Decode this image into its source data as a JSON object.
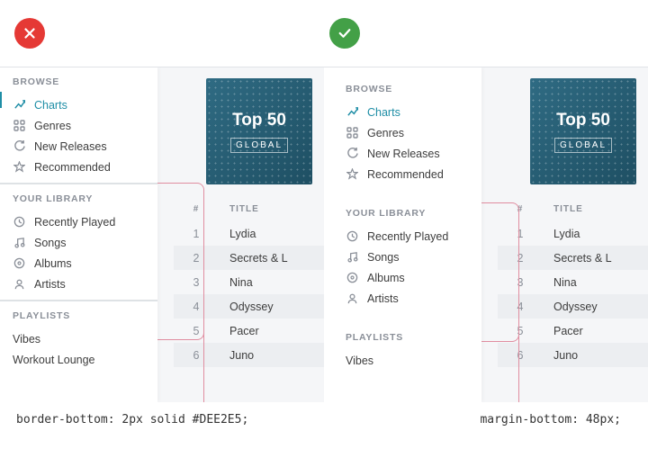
{
  "sections": {
    "browse": "BROWSE",
    "library": "YOUR LIBRARY",
    "playlists": "PLAYLISTS"
  },
  "nav": {
    "charts": "Charts",
    "genres": "Genres",
    "new_releases": "New Releases",
    "recommended": "Recommended",
    "recently_played": "Recently Played",
    "songs": "Songs",
    "albums": "Albums",
    "artists": "Artists"
  },
  "playlists": {
    "vibes": "Vibes",
    "workout": "Workout Lounge"
  },
  "card": {
    "title": "Top 50",
    "sub": "GLOBAL"
  },
  "table": {
    "col_num": "#",
    "col_title": "TITLE",
    "rows": [
      {
        "n": "1",
        "title": "Lydia"
      },
      {
        "n": "2",
        "title": "Secrets & L"
      },
      {
        "n": "3",
        "title": "Nina"
      },
      {
        "n": "4",
        "title": "Odyssey"
      },
      {
        "n": "5",
        "title": "Pacer"
      },
      {
        "n": "6",
        "title": "Juno"
      }
    ]
  },
  "code": {
    "left": "border-bottom: 2px solid #DEE2E5;",
    "right": "margin-bottom: 48px;"
  }
}
